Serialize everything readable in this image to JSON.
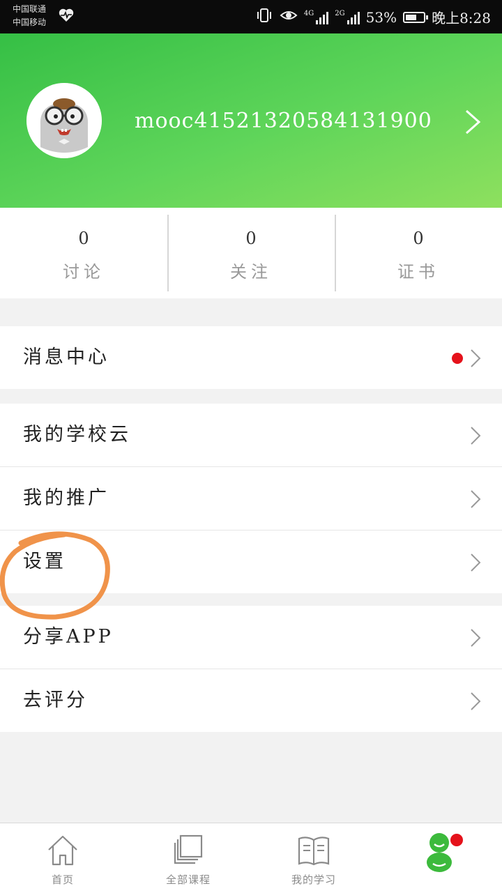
{
  "status_bar": {
    "carrier1": "中国联通",
    "carrier2": "中国移动",
    "network1": "4G",
    "network2": "2G",
    "battery": "53%",
    "battery_level": 0.53,
    "time": "晚上8:28"
  },
  "profile": {
    "username": "mooc41521320584131900"
  },
  "stats": [
    {
      "value": "0",
      "label": "讨论"
    },
    {
      "value": "0",
      "label": "关注"
    },
    {
      "value": "0",
      "label": "证书"
    }
  ],
  "menu": {
    "message_center": "消息中心",
    "school_cloud": "我的学校云",
    "promotion": "我的推广",
    "settings": "设置",
    "share_app": "分享APP",
    "rate": "去评分"
  },
  "tabs": [
    {
      "label": "首页",
      "icon": "home-icon"
    },
    {
      "label": "全部课程",
      "icon": "courses-icon"
    },
    {
      "label": "我的学习",
      "icon": "book-icon"
    },
    {
      "label": "",
      "icon": "mascot-icon"
    }
  ],
  "colors": {
    "header_green": "#4fcb4f",
    "badge_red": "#e5121b",
    "annotation_orange": "#f0934a"
  }
}
